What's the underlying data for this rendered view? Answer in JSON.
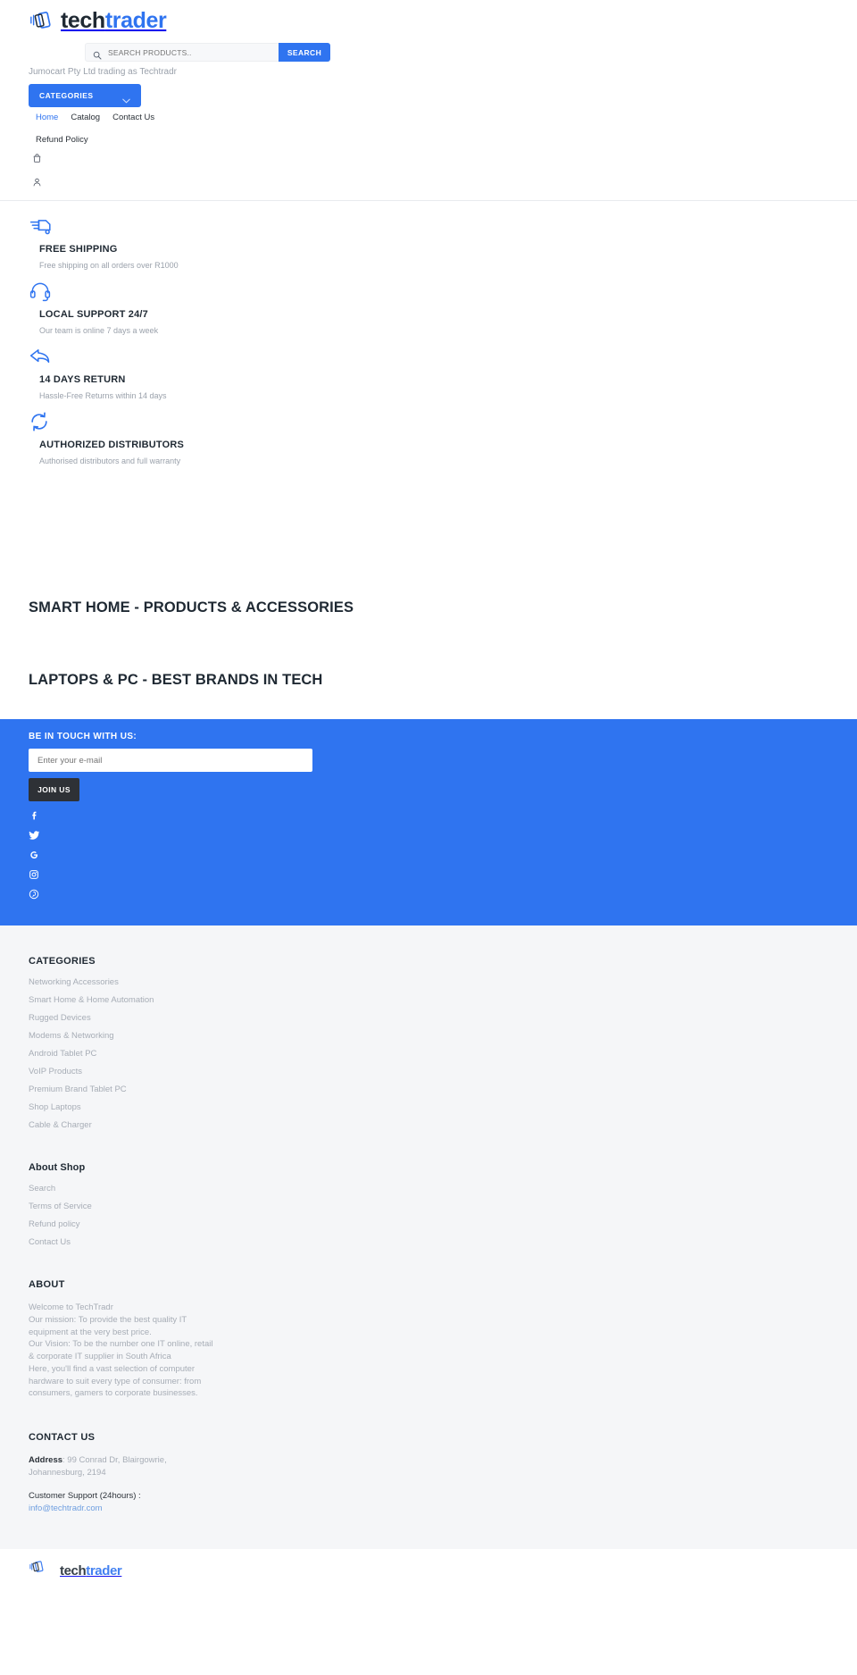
{
  "brand": {
    "name_part1": "tech",
    "name_part2": "trader",
    "logo_icon": "phones-logo-icon"
  },
  "search": {
    "placeholder": "SEARCH PRODUCTS..",
    "value": "",
    "button_label": "SEARCH",
    "icon": "search-icon"
  },
  "tagline": "Jumocart Pty Ltd trading as Techtradr",
  "categories_button": {
    "label": "CATEGORIES",
    "icon": "chevron-down-icon"
  },
  "nav": [
    {
      "label": "Home",
      "active": true
    },
    {
      "label": "Catalog",
      "active": false
    },
    {
      "label": "Contact Us",
      "active": false
    },
    {
      "label": "Refund Policy",
      "active": false
    }
  ],
  "header_icons": [
    {
      "name": "cart-icon"
    },
    {
      "name": "account-icon"
    }
  ],
  "features": [
    {
      "icon": "delivery-truck-icon",
      "title": "FREE SHIPPING",
      "text": "Free shipping on all orders over R1000"
    },
    {
      "icon": "headset-icon",
      "title": "LOCAL SUPPORT 24/7",
      "text": "Our team is online 7 days a week"
    },
    {
      "icon": "return-arrow-icon",
      "title": "14 DAYS RETURN",
      "text": "Hassle-Free Returns within 14 days"
    },
    {
      "icon": "refresh-cycle-icon",
      "title": "AUTHORIZED DISTRIBUTORS",
      "text": "Authorised distributors and full warranty"
    }
  ],
  "collections": [
    {
      "title": "SMART HOME - PRODUCTS & ACCESSORIES"
    },
    {
      "title": "LAPTOPS & PC - BEST BRANDS IN TECH"
    }
  ],
  "newsletter": {
    "title": "BE IN TOUCH WITH US:",
    "placeholder": "Enter your e-mail",
    "value": "",
    "button_label": "JOIN US",
    "background_color": "#2f74f0",
    "socials": [
      {
        "name": "facebook-icon"
      },
      {
        "name": "twitter-icon"
      },
      {
        "name": "google-icon"
      },
      {
        "name": "instagram-icon"
      },
      {
        "name": "pinterest-icon"
      }
    ]
  },
  "footer": {
    "categories": {
      "heading": "CATEGORIES",
      "items": [
        "Networking Accessories",
        "Smart Home & Home Automation",
        "Rugged Devices",
        "Modems & Networking",
        "Android Tablet PC",
        "VoIP Products",
        "Premium Brand Tablet PC",
        "Shop Laptops",
        "Cable & Charger"
      ]
    },
    "about_shop": {
      "heading": "About Shop",
      "items": [
        "Search",
        "Terms of Service",
        "Refund policy",
        "Contact Us"
      ]
    },
    "about": {
      "heading": "ABOUT",
      "lines": [
        "Welcome to TechTradr",
        "Our mission: To provide the best quality IT",
        "equipment at the very best price.",
        "Our Vision: To be the number one IT online, retail",
        "& corporate IT supplier in South Africa",
        "Here, you'll find a vast selection of computer",
        "hardware to suit every type of consumer: from",
        "consumers, gamers to corporate businesses."
      ]
    },
    "contact": {
      "heading": "CONTACT US",
      "address_label": "Address",
      "address_line1": ": 99 Conrad Dr, Blairgowrie,",
      "address_line2": "Johannesburg, 2194",
      "support_label": "Customer Support (24hours) :",
      "email": "info@techtradr.com"
    }
  },
  "colors": {
    "accent": "#2f74f0",
    "dark": "#2e3136",
    "muted": "#a7adb6",
    "footer_bg": "#f5f6f8"
  }
}
